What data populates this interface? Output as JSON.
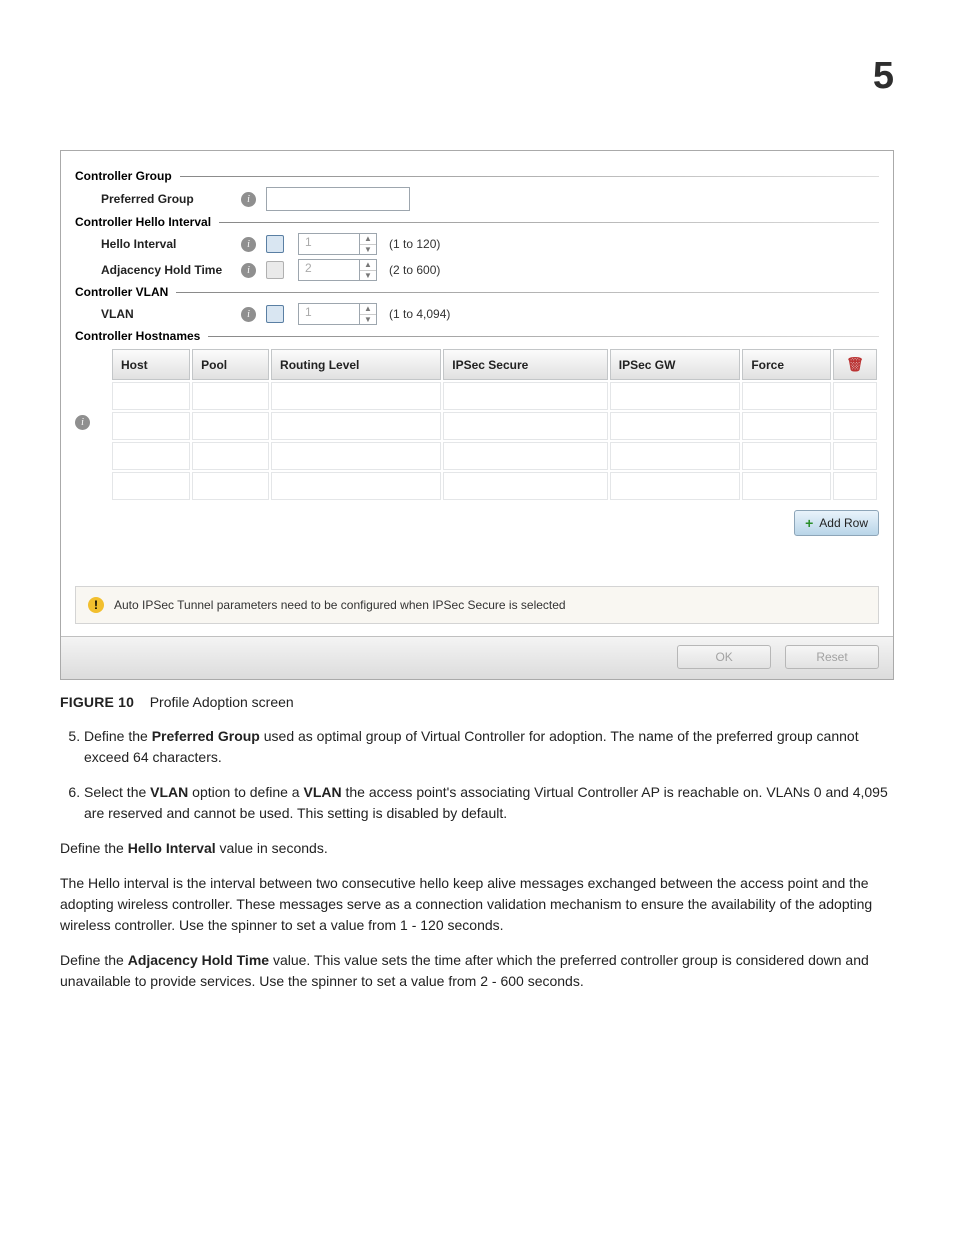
{
  "chapterNumber": "5",
  "panel": {
    "sections": {
      "controllerGroup": {
        "title": "Controller Group",
        "preferredGroupLabel": "Preferred Group",
        "preferredGroupValue": ""
      },
      "helloInterval": {
        "title": "Controller Hello Interval",
        "helloLabel": "Hello Interval",
        "helloValue": "1",
        "helloHint": "(1 to 120)",
        "adjLabel": "Adjacency Hold Time",
        "adjValue": "2",
        "adjHint": "(2 to 600)"
      },
      "vlan": {
        "title": "Controller VLAN",
        "vlanLabel": "VLAN",
        "vlanValue": "1",
        "vlanHint": "(1 to 4,094)"
      },
      "hostnames": {
        "title": "Controller Hostnames",
        "headers": [
          "Host",
          "Pool",
          "Routing Level",
          "IPSec Secure",
          "IPSec GW",
          "Force"
        ],
        "rows": 4,
        "addRowLabel": "Add Row"
      }
    },
    "notice": "Auto IPSec Tunnel parameters need to be configured when IPSec Secure is selected",
    "okLabel": "OK",
    "resetLabel": "Reset"
  },
  "caption": {
    "label": "FIGURE 10",
    "text": "Profile Adoption screen"
  },
  "steps": {
    "step5": {
      "pre": "Define the ",
      "bold": "Preferred Group",
      "post": " used as optimal group of Virtual Controller for adoption. The name of the preferred group cannot exceed 64 characters."
    },
    "step6": {
      "pre": "Select the ",
      "bold1": "VLAN",
      "mid": " option to define a ",
      "bold2": "VLAN",
      "post": " the access point's associating Virtual Controller AP is reachable on. VLANs 0 and 4,095 are reserved and cannot be used. This setting is disabled by default."
    }
  },
  "para1": {
    "pre": "Define the ",
    "bold": "Hello Interval",
    "post": " value in seconds."
  },
  "para2": "The Hello interval is the interval between two consecutive hello keep alive messages exchanged between the access point and the adopting wireless controller. These messages serve as a connection validation mechanism to ensure the availability of the adopting wireless controller. Use the spinner to set a value from 1 - 120 seconds.",
  "para3": {
    "pre": "Define the ",
    "bold": "Adjacency Hold Time",
    "post": " value. This value sets the time after which the preferred controller group is considered down and unavailable to provide services. Use the spinner to set a value from 2 - 600 seconds."
  }
}
